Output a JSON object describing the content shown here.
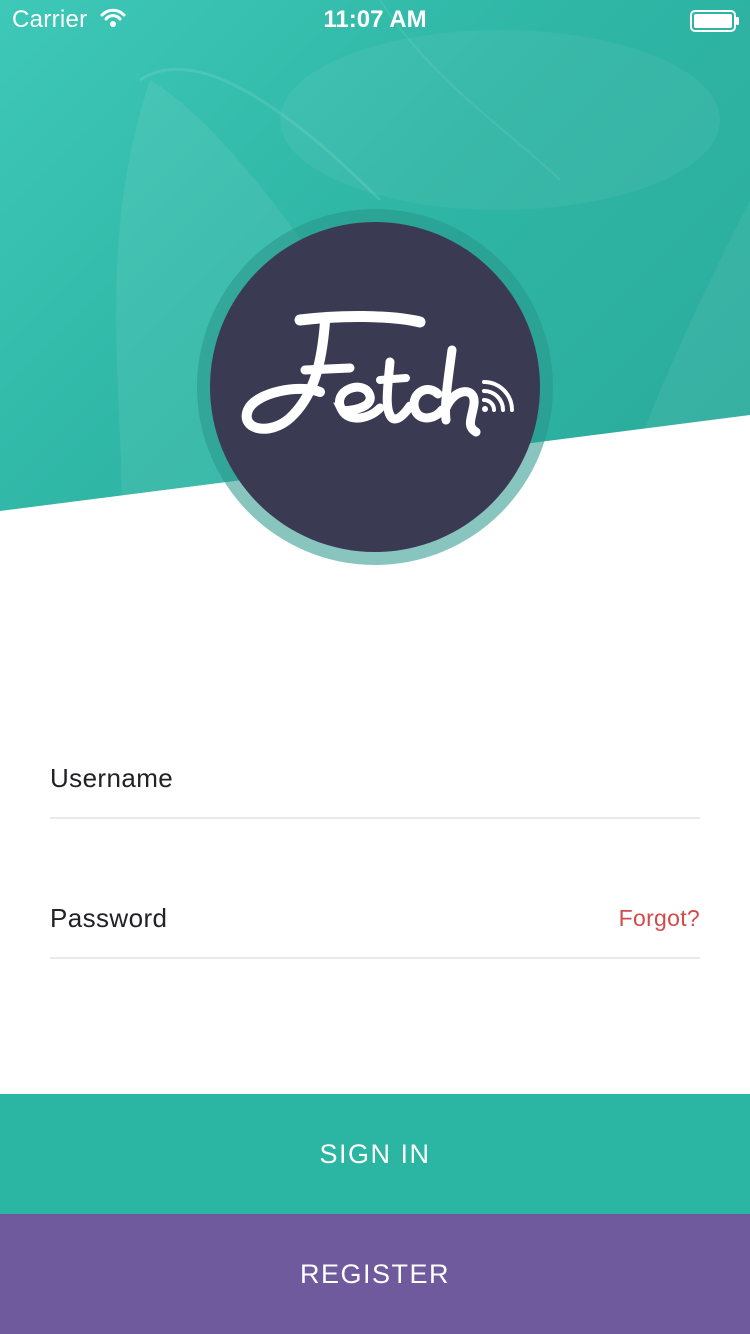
{
  "status_bar": {
    "carrier": "Carrier",
    "time": "11:07 AM",
    "icons": [
      "wifi-icon",
      "battery-icon"
    ]
  },
  "logo": {
    "name": "Fetch",
    "circle_color": "#3b3a53"
  },
  "form": {
    "username_label": "Username",
    "password_label": "Password",
    "forgot_label": "Forgot?"
  },
  "actions": {
    "sign_in_label": "SIGN IN",
    "register_label": "REGISTER"
  },
  "colors": {
    "accent_teal": "#2bb5a3",
    "register_purple": "#6e5a9c",
    "forgot_red": "#d44a4a"
  }
}
